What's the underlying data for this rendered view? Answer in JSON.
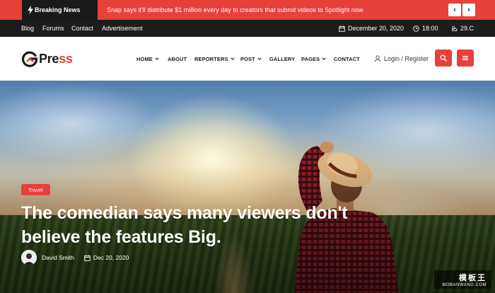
{
  "breaking": {
    "label": "Breaking News",
    "headline": "Snap says it'll distribute $1 million every day to creators that submit videos to Spotlight now",
    "prev": "‹",
    "next": "›"
  },
  "topbar": {
    "links": [
      "Blog",
      "Forums",
      "Contact",
      "Advertisement"
    ],
    "date": "December 20, 2020",
    "time": "18:00",
    "weather": "29.C"
  },
  "header": {
    "logo_prefix": "G",
    "logo_main": "Pre",
    "logo_accent": "ss",
    "menu": [
      {
        "label": "HOME",
        "dropdown": true
      },
      {
        "label": "ABOUT",
        "dropdown": false
      },
      {
        "label": "REPORTERS",
        "dropdown": true
      },
      {
        "label": "POST",
        "dropdown": true
      },
      {
        "label": "GALLERY",
        "dropdown": false
      },
      {
        "label": "PAGES",
        "dropdown": true
      },
      {
        "label": "CONTACT",
        "dropdown": false
      }
    ],
    "login": "Login / Register"
  },
  "hero": {
    "category": "Travel",
    "title": "The comedian says many viewers don't believe the features Big.",
    "author": "David Smith",
    "date": "Dec 20, 2020"
  },
  "watermark": {
    "top": "模板王",
    "bottom": "MOBANWANG.COM"
  },
  "colors": {
    "accent": "#e6413b",
    "dark": "#1c1c1c"
  }
}
